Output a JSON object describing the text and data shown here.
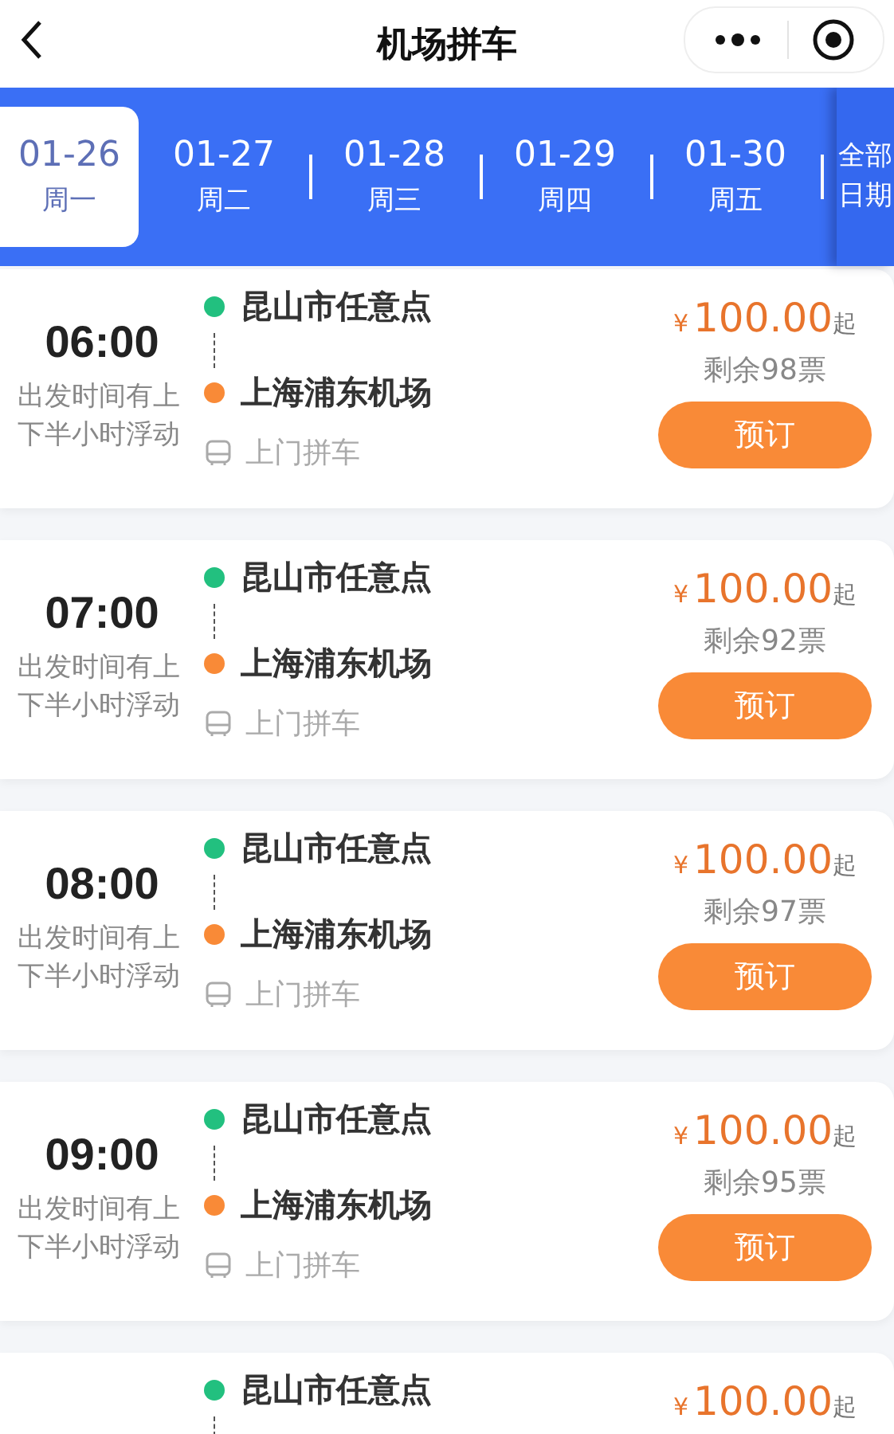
{
  "header": {
    "title": "机场拼车"
  },
  "dates": [
    {
      "date": "01-26",
      "weekday": "周一",
      "selected": true
    },
    {
      "date": "01-27",
      "weekday": "周二",
      "selected": false
    },
    {
      "date": "01-28",
      "weekday": "周三",
      "selected": false
    },
    {
      "date": "01-29",
      "weekday": "周四",
      "selected": false
    },
    {
      "date": "01-30",
      "weekday": "周五",
      "selected": false
    }
  ],
  "all_dates": "全部日期",
  "trips": [
    {
      "time": "06:00",
      "note": "出发时间有上下半小时浮动",
      "from": "昆山市任意点",
      "to": "上海浦东机场",
      "service": "上门拼车",
      "currency": "¥",
      "price": "100.00",
      "price_suffix": "起",
      "remaining": "剩余98票",
      "button": "预订"
    },
    {
      "time": "07:00",
      "note": "出发时间有上下半小时浮动",
      "from": "昆山市任意点",
      "to": "上海浦东机场",
      "service": "上门拼车",
      "currency": "¥",
      "price": "100.00",
      "price_suffix": "起",
      "remaining": "剩余92票",
      "button": "预订"
    },
    {
      "time": "08:00",
      "note": "出发时间有上下半小时浮动",
      "from": "昆山市任意点",
      "to": "上海浦东机场",
      "service": "上门拼车",
      "currency": "¥",
      "price": "100.00",
      "price_suffix": "起",
      "remaining": "剩余97票",
      "button": "预订"
    },
    {
      "time": "09:00",
      "note": "出发时间有上下半小时浮动",
      "from": "昆山市任意点",
      "to": "上海浦东机场",
      "service": "上门拼车",
      "currency": "¥",
      "price": "100.00",
      "price_suffix": "起",
      "remaining": "剩余95票",
      "button": "预订"
    },
    {
      "from": "昆山市任意点",
      "currency": "¥",
      "price": "100.00",
      "price_suffix": "起"
    }
  ]
}
